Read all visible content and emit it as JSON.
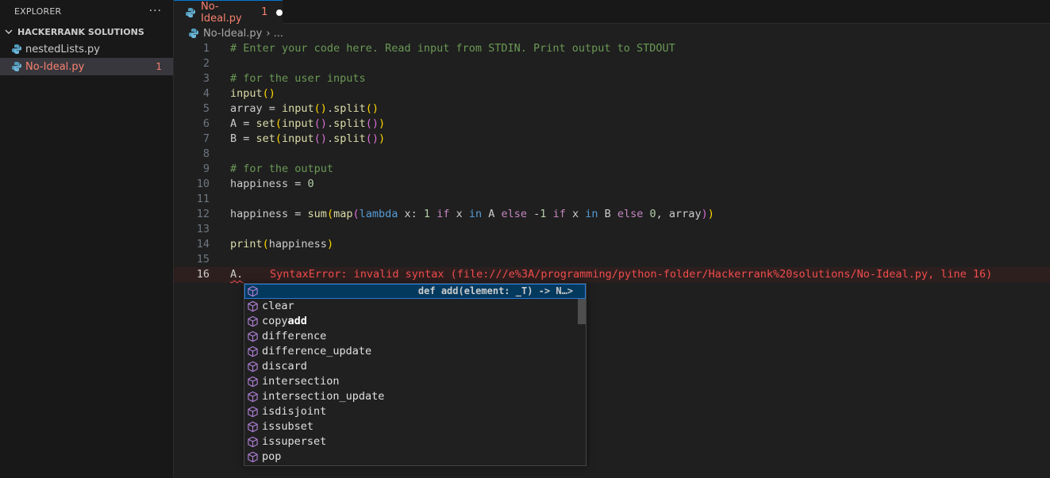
{
  "explorer": {
    "title": "EXPLORER",
    "more_label": "···",
    "folder_name": "HACKERRANK SOLUTIONS",
    "files": [
      {
        "name": "nestedLists.py",
        "badge": ""
      },
      {
        "name": "No-Ideal.py",
        "badge": "1"
      }
    ]
  },
  "tab": {
    "label": "No-Ideal.py",
    "badge": "1"
  },
  "breadcrumb": {
    "file": "No-Ideal.py",
    "separator": "›",
    "more": "..."
  },
  "editor": {
    "current_line": 16,
    "error_message": "SyntaxError: invalid syntax (file:///e%3A/programming/python-folder/Hackerrank%20solutions/No-Ideal.py, line 16)"
  },
  "suggest": {
    "selected_detail": "def add(element: _T) -> N…>",
    "items": [
      "add",
      "clear",
      "copy",
      "difference",
      "difference_update",
      "discard",
      "intersection",
      "intersection_update",
      "isdisjoint",
      "issubset",
      "issuperset",
      "pop"
    ]
  },
  "colors": {
    "accent": "#0078d4",
    "error": "#f14c4c",
    "selection": "#04395e",
    "method_icon": "#b180d7",
    "python_icon": "#519aba"
  }
}
